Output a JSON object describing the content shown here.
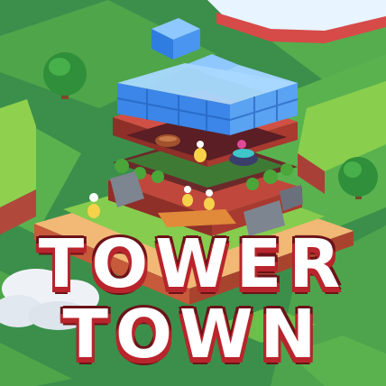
{
  "title": {
    "line1": "TOWER",
    "line2": "TOWN"
  },
  "colors": {
    "grass_light": "#7fc24a",
    "grass_dark": "#3f9a3a",
    "dirt": "#f0b070",
    "brick": "#a83a30",
    "glass_block": "#5fa8ff",
    "title_text": "#ffffff",
    "title_shadow": "#b8252c"
  },
  "icons": [
    "tree-icon",
    "glass-block-icon",
    "sausage-icon",
    "sprout-creature-icon",
    "cauldron-icon",
    "cloud-icon"
  ]
}
